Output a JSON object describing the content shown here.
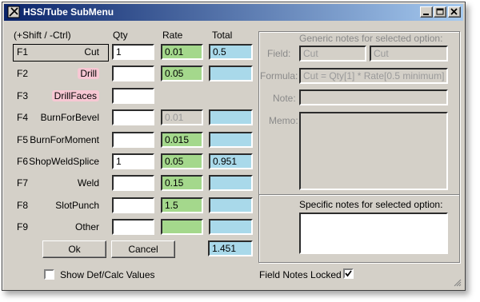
{
  "window": {
    "title": "HSS/Tube SubMenu",
    "icon": "tools-icon",
    "controls": [
      "minimize-icon",
      "maximize-icon",
      "close-icon"
    ]
  },
  "headers": {
    "shortcut": "(+Shift / -Ctrl)",
    "qty": "Qty",
    "rate": "Rate",
    "total": "Total"
  },
  "rows": [
    {
      "key": "F1",
      "name": "Cut",
      "highlight": false,
      "qty": "1",
      "rate": "0.01",
      "total": "0.5",
      "rate_enabled": true,
      "total_shown": true
    },
    {
      "key": "F2",
      "name": "Drill",
      "highlight": true,
      "qty": "",
      "rate": "0.05",
      "total": "",
      "rate_enabled": true,
      "total_shown": true
    },
    {
      "key": "F3",
      "name": "DrillFaces",
      "highlight": true,
      "qty": "",
      "rate": null,
      "total": null,
      "rate_enabled": false,
      "total_shown": false
    },
    {
      "key": "F4",
      "name": "BurnForBevel",
      "highlight": false,
      "qty": "",
      "rate": "0.01",
      "total": "",
      "rate_enabled": false,
      "total_shown": true
    },
    {
      "key": "F5",
      "name": "BurnForMoment",
      "highlight": false,
      "qty": "",
      "rate": "0.015",
      "total": "",
      "rate_enabled": true,
      "total_shown": true
    },
    {
      "key": "F6",
      "name": "ShopWeldSplice",
      "highlight": false,
      "qty": "1",
      "rate": "0.05",
      "total": "0.951",
      "rate_enabled": true,
      "total_shown": true
    },
    {
      "key": "F7",
      "name": "Weld",
      "highlight": false,
      "qty": "",
      "rate": "0.15",
      "total": "",
      "rate_enabled": true,
      "total_shown": true
    },
    {
      "key": "F8",
      "name": "SlotPunch",
      "highlight": false,
      "qty": "",
      "rate": "1.5",
      "total": "",
      "rate_enabled": true,
      "total_shown": true
    },
    {
      "key": "F9",
      "name": "Other",
      "highlight": false,
      "qty": "",
      "rate": "",
      "total": "",
      "rate_enabled": true,
      "total_shown": true
    }
  ],
  "buttons": {
    "ok": "Ok",
    "cancel": "Cancel"
  },
  "grand_total": "1.451",
  "show_def_calc": {
    "label": "Show Def/Calc Values",
    "checked": false
  },
  "notes": {
    "generic_title": "Generic notes for selected option:",
    "field_label": "Field:",
    "field_value_1": "Cut",
    "field_value_2": "Cut",
    "formula_label": "Formula:",
    "formula_value": "Cut = Qty[1] * Rate[0.5 minimum]",
    "note_label": "Note:",
    "note_value": "",
    "memo_label": "Memo:",
    "memo_value": "",
    "specific_title": "Specific notes for selected option:",
    "specific_value": ""
  },
  "field_notes_locked": {
    "label": "Field Notes Locked",
    "checked": true
  },
  "colors": {
    "rate_fill": "#a4d88c",
    "total_fill": "#a9d9ea",
    "highlight_label": "#f7c7d3",
    "title_bar": "#0a246a"
  }
}
